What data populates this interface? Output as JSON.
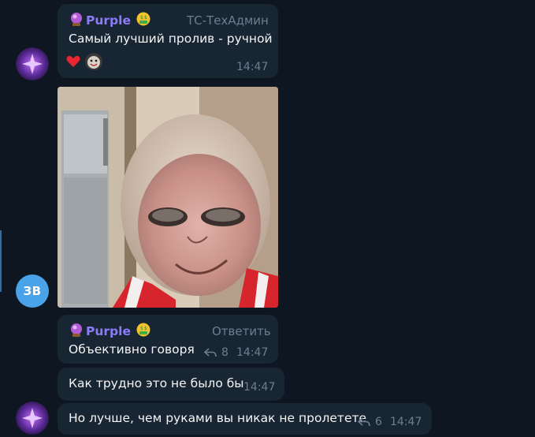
{
  "messages": [
    {
      "sender": "Purple",
      "role": "ТС-ТехАдмин",
      "text": "Самый лучший пролив - ручной",
      "time": "14:47"
    },
    {
      "sender": "Purple",
      "role": "Ответить",
      "text": "Объективно говоря",
      "replies": "8",
      "time": "14:47"
    },
    {
      "text": "Как трудно это не было бы",
      "time": "14:47"
    },
    {
      "text": "Но лучше, чем руками вы никак не пролетете",
      "replies": "6",
      "time": "14:47"
    }
  ],
  "avatars": {
    "zb_initials": "ЗВ"
  },
  "reactions": [
    "heart",
    "dog-face"
  ],
  "colors": {
    "background": "#0e1621",
    "bubble": "#182533",
    "sender": "#8b7cf6",
    "muted": "#6d7f8f",
    "avatar_zb": "#4aa3e8"
  }
}
